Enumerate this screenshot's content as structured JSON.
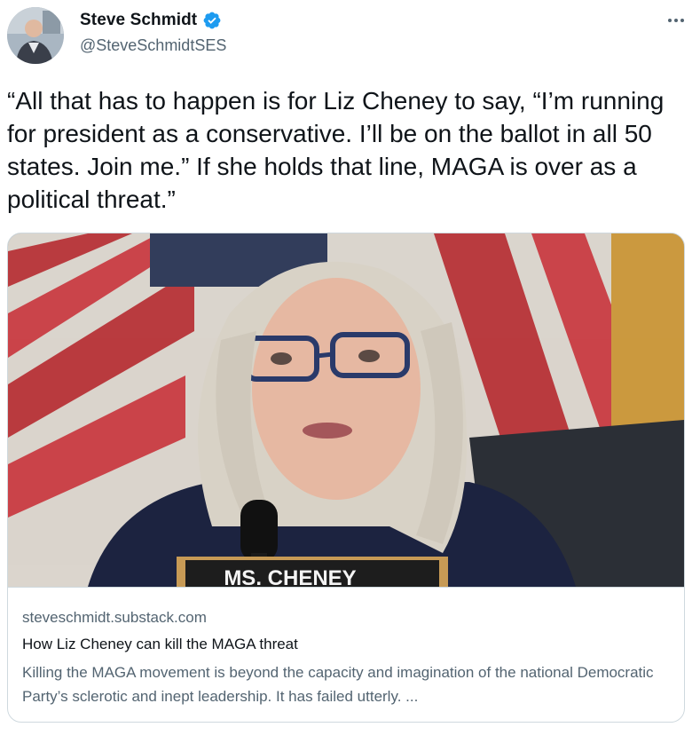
{
  "author": {
    "display_name": "Steve Schmidt",
    "handle": "@SteveSchmidtSES",
    "verified": true,
    "avatar_icon": "user-avatar-photo"
  },
  "tweet": {
    "text": "“All that has to happen is for Liz Cheney to say, “I’m running for president as a conservative. I’ll be on the ballot in all 50 states. Join me.” If she holds that line, MAGA is over as a political threat.”"
  },
  "card": {
    "image_caption_text": "MS. CHENEY",
    "domain": "steveschmidt.substack.com",
    "title": "How Liz Cheney can kill the MAGA threat",
    "description": "Killing the MAGA movement is beyond the capacity and imagination of the national Democratic Party’s sclerotic and inept leadership. It has failed utterly. ..."
  },
  "colors": {
    "text_primary": "#0f1419",
    "text_secondary": "#536471",
    "verified_blue": "#1d9bf0",
    "border": "#cfd9de"
  },
  "icons": {
    "more": "more-horizontal-icon",
    "verified": "verified-badge-icon"
  }
}
